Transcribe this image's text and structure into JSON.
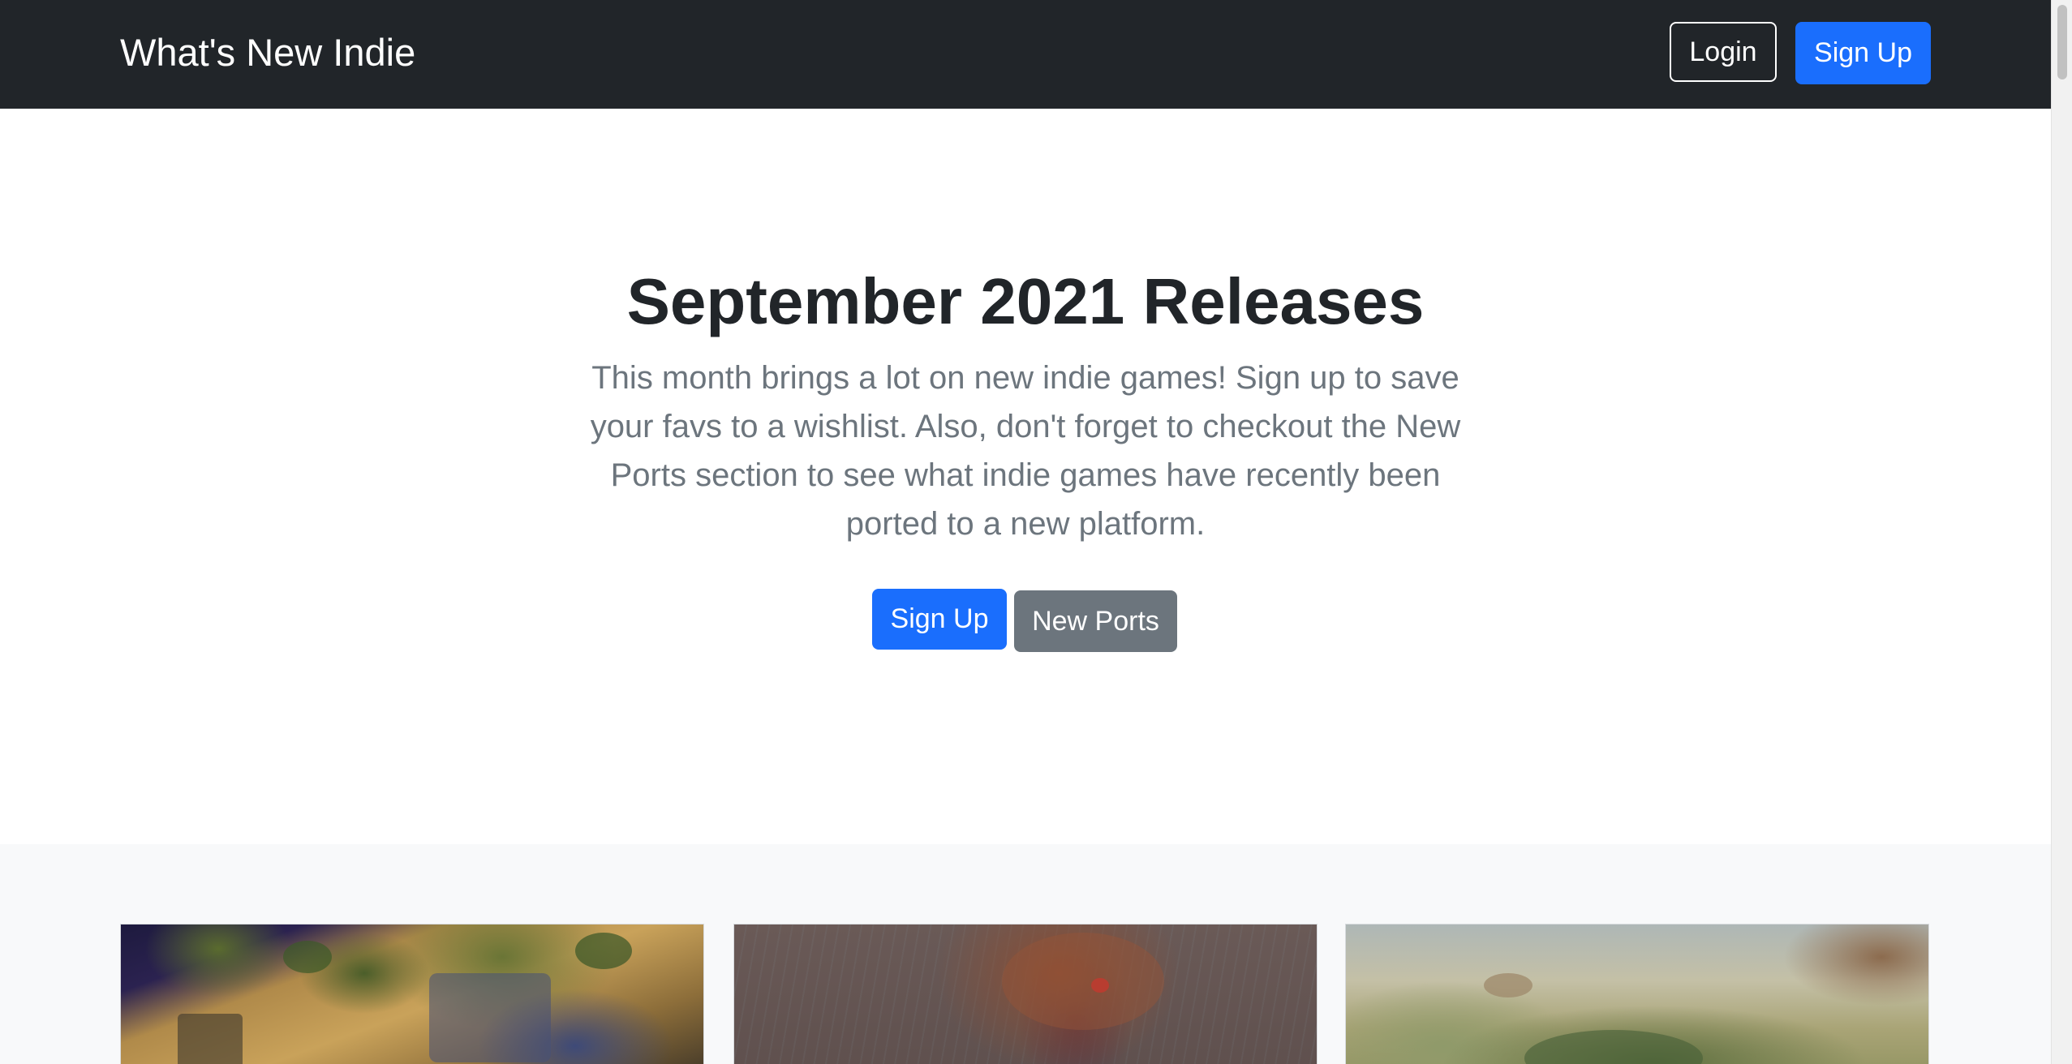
{
  "navbar": {
    "brand": "What's New Indie",
    "login_label": "Login",
    "signup_label": "Sign Up",
    "background_color": "#212529"
  },
  "hero": {
    "title": "September 2021 Releases",
    "lead": "This month brings a lot on new indie games! Sign up to save your favs to a wishlist. Also, don't forget to checkout the New Ports section to see what indie games have recently been ported to a new platform.",
    "primary_button": "Sign Up",
    "secondary_button": "New Ports"
  },
  "album": {
    "cards": [
      {
        "image_icon": "village-game-screenshot"
      },
      {
        "image_icon": "forest-rain-game-screenshot"
      },
      {
        "image_icon": "hills-landscape-game-screenshot"
      }
    ]
  },
  "colors": {
    "primary": "#1a6efd",
    "secondary": "#6c757d",
    "muted_text": "#6c757d",
    "dark_text": "#212529",
    "album_bg": "#f8f9fa"
  }
}
